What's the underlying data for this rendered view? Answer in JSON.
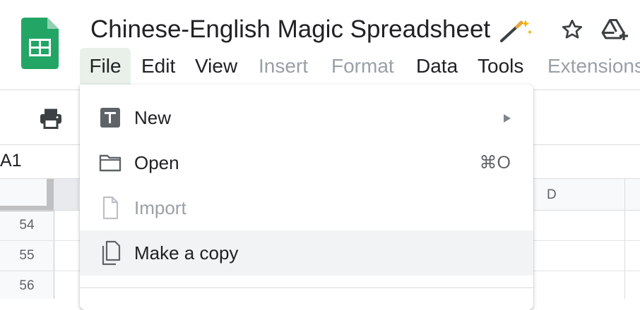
{
  "document": {
    "title": "Chinese-English Magic Spreadsheet"
  },
  "menubar": [
    {
      "label": "File",
      "state": "active"
    },
    {
      "label": "Edit",
      "state": "enabled"
    },
    {
      "label": "View",
      "state": "enabled"
    },
    {
      "label": "Insert",
      "state": "disabled"
    },
    {
      "label": "Format",
      "state": "disabled"
    },
    {
      "label": "Data",
      "state": "enabled"
    },
    {
      "label": "Tools",
      "state": "enabled"
    },
    {
      "label": "Extensions",
      "state": "disabled"
    }
  ],
  "toolbar": {
    "name_box": "A1"
  },
  "sheet": {
    "visible_column": "D",
    "row_numbers": [
      "54",
      "55",
      "56"
    ]
  },
  "file_menu": {
    "items": [
      {
        "label": "New",
        "icon": "new-doc-icon",
        "submenu": true,
        "shortcut": ""
      },
      {
        "label": "Open",
        "icon": "folder-icon",
        "submenu": false,
        "shortcut": "⌘O"
      },
      {
        "label": "Import",
        "icon": "file-icon",
        "submenu": false,
        "shortcut": "",
        "disabled": true
      },
      {
        "label": "Make a copy",
        "icon": "copy-icon",
        "submenu": false,
        "shortcut": "",
        "highlighted": true
      }
    ]
  },
  "colors": {
    "sheets_green": "#23a566",
    "menu_active_bg": "#e8f0e9",
    "hover_bg": "#f1f3f4",
    "disabled_text": "#9aa0a6"
  }
}
